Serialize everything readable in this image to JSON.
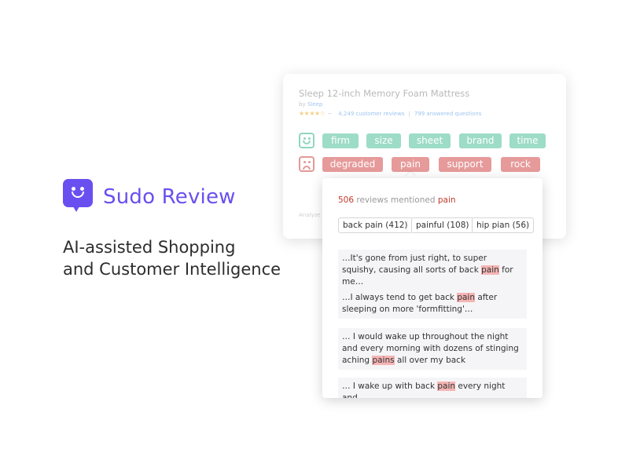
{
  "brand": {
    "name": "Sudo Review",
    "tagline_line1": "AI-assisted Shopping",
    "tagline_line2": "and Customer Intelligence",
    "color": "#6a4ff0",
    "logo_icon": "chat-bubble-smile-icon"
  },
  "product": {
    "title": "Sleep 12-inch Memory Foam Mattress",
    "by_prefix": "by",
    "brand": "Sleep",
    "stars": "★★★★☆",
    "star_suffix": "~",
    "reviews": "4,249 customer reviews",
    "separator": "|",
    "questions": "799 answered questions",
    "analyzed": "Analyze"
  },
  "positive_tags": [
    "firm",
    "size",
    "sheet",
    "brand",
    "time"
  ],
  "negative_tags": [
    "degraded",
    "pain",
    "support",
    "rock"
  ],
  "colors": {
    "positive": "#9ddcc6",
    "negative": "#e69a9a",
    "highlight": "#f5b5b5",
    "count": "#c0392b"
  },
  "popup": {
    "count": "506",
    "mid_text": " reviews mentioned ",
    "keyword": "pain",
    "chips": [
      "back pain (412)",
      "painful (108)",
      "hip pian (56)"
    ],
    "snippets": [
      {
        "before": "…It's gone from just right, to super squishy, causing all sorts of back ",
        "hl": "pain",
        "after": " for me…"
      },
      {
        "before": "…I always tend to get back ",
        "hl": "pain",
        "after": " after sleeping on more 'formfitting'…"
      },
      {
        "before": "… I would wake up throughout the night and every morning with dozens of stinging aching ",
        "hl": "pains",
        "after": " all over my back"
      },
      {
        "before": "… I wake up with back ",
        "hl": "pain",
        "after": " every night and"
      }
    ]
  }
}
